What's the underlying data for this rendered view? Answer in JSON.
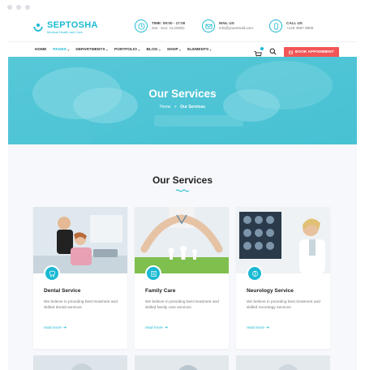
{
  "site": {
    "logo": {
      "name": "SEPTOSHA",
      "tagline": "Medical Health and Care"
    },
    "info": [
      {
        "icon": "clock-icon",
        "title": "TIME: 09:00 - 17:00",
        "sub": "Sat - Sun: CLOSED"
      },
      {
        "icon": "mail-icon",
        "title": "MAIL US",
        "sub": "info@youremail.com"
      },
      {
        "icon": "phone-icon",
        "title": "CALL US",
        "sub": "+123 4567 8900"
      }
    ]
  },
  "nav": {
    "items": [
      {
        "label": "HOME",
        "active": false
      },
      {
        "label": "PAGES",
        "active": true
      },
      {
        "label": "DEPARTMENTS",
        "active": false
      },
      {
        "label": "PORTFOLIO",
        "active": false
      },
      {
        "label": "BLOG",
        "active": false
      },
      {
        "label": "SHOP",
        "active": false
      },
      {
        "label": "ELEMENTS",
        "active": false
      }
    ],
    "book_label": "BOOK APPOINMENT"
  },
  "hero": {
    "title": "Our Services",
    "crumb_home": "Home",
    "crumb_sep": ">",
    "crumb_current": "Our Services"
  },
  "services": {
    "title": "Our Services",
    "cards": [
      {
        "icon": "tooth-icon",
        "title": "Dental Service",
        "desc": "We believe in providing best treatment and skilled dental services",
        "more": "read more"
      },
      {
        "icon": "family-icon",
        "title": "Family Care",
        "desc": "We believe in providing best treatment and skilled family care services",
        "more": "read more"
      },
      {
        "icon": "brain-icon",
        "title": "Neurology Service",
        "desc": "We believe in providing best treatment and skilled neurology services",
        "more": "read more"
      }
    ]
  },
  "colors": {
    "accent": "#1bb9d3",
    "cta": "#f25656",
    "hero": "#5fcbd9"
  }
}
